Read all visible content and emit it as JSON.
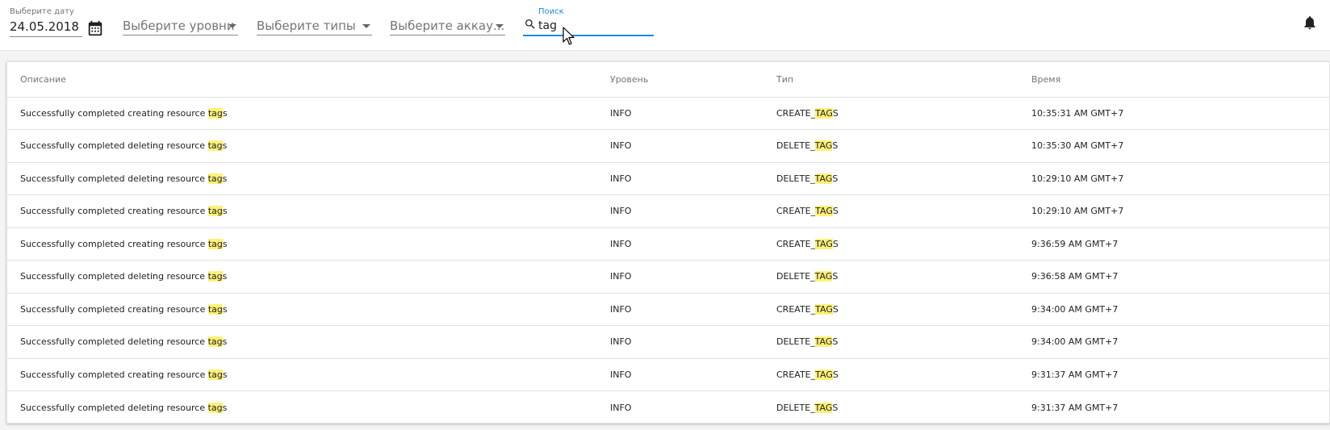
{
  "filters": {
    "date": {
      "label": "Выберите дату",
      "value": "24.05.2018",
      "icon": "calendar-icon"
    },
    "levels": {
      "placeholder": "Выберите уровни"
    },
    "types": {
      "placeholder": "Выберите типы"
    },
    "accounts": {
      "placeholder": "Выберите аккау..."
    },
    "search": {
      "label": "Поиск",
      "value": "tag",
      "icon": "search-icon"
    }
  },
  "header": {
    "notification_icon": "bell-icon"
  },
  "colors": {
    "accent": "#1e88e5",
    "highlight": "#fff176"
  },
  "table": {
    "columns": [
      "Описание",
      "Уровень",
      "Тип",
      "Время"
    ],
    "rows": [
      {
        "desc": "Successfully completed creating resource ",
        "desc_match": "tag",
        "desc_rest": "s",
        "level": "INFO",
        "type": "CREATE_",
        "type_match": "TAG",
        "type_rest": "S",
        "time": "10:35:31 AM GMT+7"
      },
      {
        "desc": "Successfully completed deleting resource ",
        "desc_match": "tag",
        "desc_rest": "s",
        "level": "INFO",
        "type": "DELETE_",
        "type_match": "TAG",
        "type_rest": "S",
        "time": "10:35:30 AM GMT+7"
      },
      {
        "desc": "Successfully completed deleting resource ",
        "desc_match": "tag",
        "desc_rest": "s",
        "level": "INFO",
        "type": "DELETE_",
        "type_match": "TAG",
        "type_rest": "S",
        "time": "10:29:10 AM GMT+7"
      },
      {
        "desc": "Successfully completed creating resource ",
        "desc_match": "tag",
        "desc_rest": "s",
        "level": "INFO",
        "type": "CREATE_",
        "type_match": "TAG",
        "type_rest": "S",
        "time": "10:29:10 AM GMT+7"
      },
      {
        "desc": "Successfully completed creating resource ",
        "desc_match": "tag",
        "desc_rest": "s",
        "level": "INFO",
        "type": "CREATE_",
        "type_match": "TAG",
        "type_rest": "S",
        "time": "9:36:59 AM GMT+7"
      },
      {
        "desc": "Successfully completed deleting resource ",
        "desc_match": "tag",
        "desc_rest": "s",
        "level": "INFO",
        "type": "DELETE_",
        "type_match": "TAG",
        "type_rest": "S",
        "time": "9:36:58 AM GMT+7"
      },
      {
        "desc": "Successfully completed creating resource ",
        "desc_match": "tag",
        "desc_rest": "s",
        "level": "INFO",
        "type": "CREATE_",
        "type_match": "TAG",
        "type_rest": "S",
        "time": "9:34:00 AM GMT+7"
      },
      {
        "desc": "Successfully completed deleting resource ",
        "desc_match": "tag",
        "desc_rest": "s",
        "level": "INFO",
        "type": "DELETE_",
        "type_match": "TAG",
        "type_rest": "S",
        "time": "9:34:00 AM GMT+7"
      },
      {
        "desc": "Successfully completed creating resource ",
        "desc_match": "tag",
        "desc_rest": "s",
        "level": "INFO",
        "type": "CREATE_",
        "type_match": "TAG",
        "type_rest": "S",
        "time": "9:31:37 AM GMT+7"
      },
      {
        "desc": "Successfully completed deleting resource ",
        "desc_match": "tag",
        "desc_rest": "s",
        "level": "INFO",
        "type": "DELETE_",
        "type_match": "TAG",
        "type_rest": "S",
        "time": "9:31:37 AM GMT+7"
      }
    ]
  }
}
